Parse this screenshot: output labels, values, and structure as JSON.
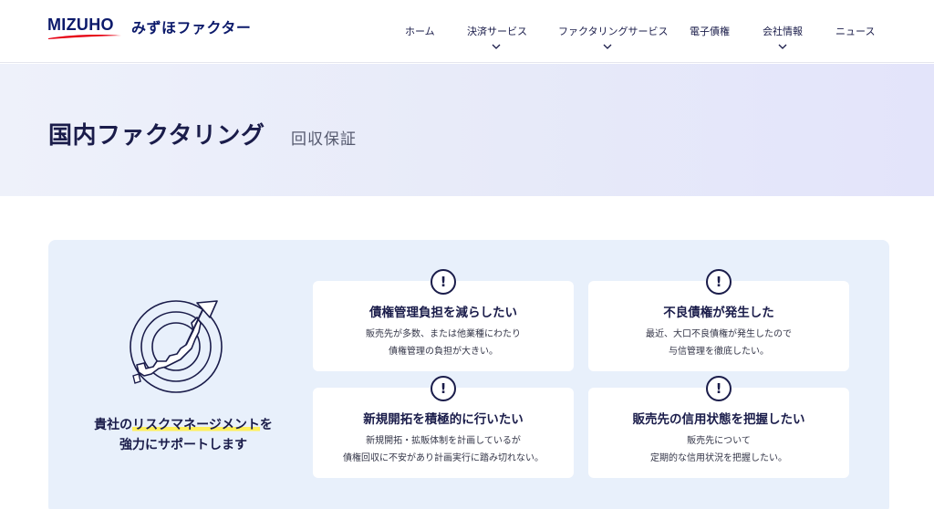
{
  "brand": {
    "logo_text": "MIZUHO",
    "company_name": "みずほファクター"
  },
  "nav": {
    "items": [
      {
        "label": "ホーム",
        "has_dropdown": false
      },
      {
        "label": "決済サービス",
        "has_dropdown": true
      },
      {
        "label": "ファクタリングサービス",
        "has_dropdown": true
      },
      {
        "label": "電子債権",
        "has_dropdown": false
      },
      {
        "label": "会社情報",
        "has_dropdown": true
      },
      {
        "label": "ニュース",
        "has_dropdown": false
      }
    ]
  },
  "hero": {
    "title": "国内ファクタリング",
    "subtitle": "回収保証"
  },
  "intro": {
    "line1_prefix": "貴社の",
    "line1_highlight": "リスクマネージメント",
    "line1_suffix": "を",
    "line2": "強力にサポートします"
  },
  "cards": [
    {
      "icon": "exclamation-icon",
      "title": "債権管理負担を減らしたい",
      "lines": [
        "販売先が多数、または他業種にわたり",
        "債権管理の負担が大きい。"
      ]
    },
    {
      "icon": "exclamation-icon",
      "title": "不良債権が発生した",
      "lines": [
        "最近、大口不良債権が発生したので",
        "与信管理を徹底したい。"
      ]
    },
    {
      "icon": "exclamation-icon",
      "title": "新規開拓を積極的に行いたい",
      "lines": [
        "新規開拓・拡販体制を計画しているが",
        "債権回収に不安があり計画実行に踏み切れない。"
      ]
    },
    {
      "icon": "exclamation-icon",
      "title": "販売先の信用状態を把握したい",
      "lines": [
        "販売先について",
        "定期的な信用状況を把握したい。"
      ]
    }
  ],
  "colors": {
    "brand_navy": "#0c1a6b",
    "brand_red": "#e60012",
    "text_navy": "#1a1c4a",
    "panel_bg": "#e8f0fb",
    "highlight_yellow": "#fff05a"
  }
}
